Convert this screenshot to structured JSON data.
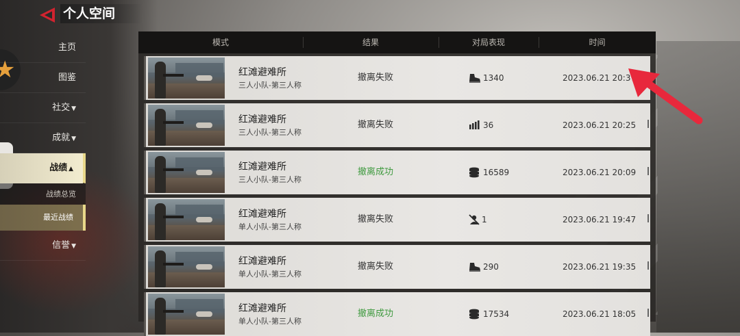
{
  "header": {
    "title": "个人空间"
  },
  "sidebar": {
    "items": [
      {
        "label": "主页",
        "arrow": ""
      },
      {
        "label": "图鉴",
        "arrow": ""
      },
      {
        "label": "社交",
        "arrow": "▼"
      },
      {
        "label": "成就",
        "arrow": "▼"
      },
      {
        "label": "战绩",
        "arrow": "▲"
      }
    ],
    "sub": [
      {
        "label": "战绩总览"
      },
      {
        "label": "最近战绩"
      }
    ],
    "after": [
      {
        "label": "信誉",
        "arrow": "▼"
      }
    ]
  },
  "table": {
    "headers": {
      "mode": "模式",
      "result": "结果",
      "perf": "对局表现",
      "time": "时间"
    },
    "rows": [
      {
        "map": "红滩避难所",
        "mode": "三人小队-第三人称",
        "result": "撤离失败",
        "perf_icon": "boot-icon",
        "perf": "1340",
        "time": "2023.06.21  20:37"
      },
      {
        "map": "红滩避难所",
        "mode": "三人小队-第三人称",
        "result": "撤离失败",
        "perf_icon": "ammo-icon",
        "perf": "36",
        "time": "2023.06.21  20:25"
      },
      {
        "map": "红滩避难所",
        "mode": "三人小队-第三人称",
        "result": "撤离成功",
        "perf_icon": "coins-icon",
        "perf": "16589",
        "time": "2023.06.21  20:09"
      },
      {
        "map": "红滩避难所",
        "mode": "单人小队-第三人称",
        "result": "撤离失败",
        "perf_icon": "kill-icon",
        "perf": "1",
        "time": "2023.06.21  19:47"
      },
      {
        "map": "红滩避难所",
        "mode": "单人小队-第三人称",
        "result": "撤离失败",
        "perf_icon": "boot-icon",
        "perf": "290",
        "time": "2023.06.21  19:35"
      },
      {
        "map": "红滩避难所",
        "mode": "单人小队-第三人称",
        "result": "撤离成功",
        "perf_icon": "coins-icon",
        "perf": "17534",
        "time": "2023.06.21  18:05"
      }
    ]
  },
  "colors": {
    "success": "#3f9a3f",
    "annotation": "#e8283c",
    "active_tab": "#f2eccf"
  }
}
